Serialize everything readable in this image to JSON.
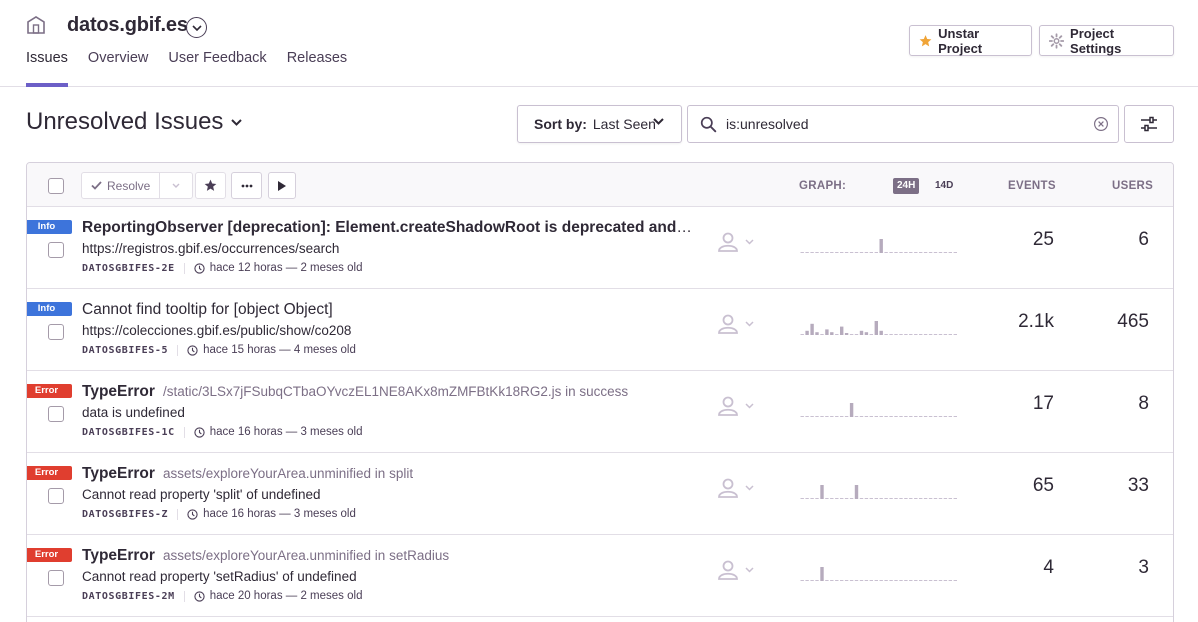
{
  "project": {
    "name": "datos.gbif.es"
  },
  "nav": {
    "tabs": [
      {
        "label": "Issues"
      },
      {
        "label": "Overview"
      },
      {
        "label": "User Feedback"
      },
      {
        "label": "Releases"
      }
    ]
  },
  "header_buttons": {
    "unstar": "Unstar Project",
    "settings": "Project Settings"
  },
  "page": {
    "title": "Unresolved Issues"
  },
  "sort": {
    "label": "Sort by:",
    "value": "Last Seen"
  },
  "search": {
    "value": "is:unresolved"
  },
  "list_header": {
    "resolve": "Resolve",
    "graph": "GRAPH:",
    "toggle_24h": "24H",
    "toggle_14d": "14D",
    "events": "EVENTS",
    "users": "USERS"
  },
  "colors": {
    "accent": "#6c5fc7",
    "info": "#3d74db",
    "error": "#e03e2f"
  },
  "issues": [
    {
      "level": "Info",
      "title": "ReportingObserver [deprecation]: Element.createShadowRoot is deprecated and w…",
      "location": "",
      "message": "https://registros.gbif.es/occurrences/search",
      "short_id": "DATOSGBIFES-2E",
      "time": "hace 12 horas — 2 meses old",
      "events": "25",
      "users": "6",
      "spark": [
        0,
        0,
        0,
        0,
        0,
        0,
        0,
        0,
        0,
        0,
        0,
        0,
        0,
        0,
        0,
        0,
        1,
        0,
        0,
        0,
        0,
        0,
        0,
        0,
        0,
        0,
        0,
        0,
        0,
        0,
        0,
        0
      ]
    },
    {
      "level": "Info",
      "title": "Cannot find tooltip for [object Object]",
      "location": "",
      "message": "https://colecciones.gbif.es/public/show/co208",
      "short_id": "DATOSGBIFES-5",
      "time": "hace 15 horas — 4 meses old",
      "events": "2.1k",
      "users": "465",
      "spark": [
        0,
        3,
        8,
        2,
        0,
        4,
        2,
        0,
        6,
        1,
        0,
        0,
        3,
        2,
        0,
        10,
        3,
        0,
        0,
        0,
        0,
        0,
        0,
        0,
        0,
        0,
        0,
        0,
        0,
        0,
        0,
        0
      ]
    },
    {
      "level": "Error",
      "title": "TypeError",
      "location": "/static/3LSx7jFSubqCTbaOYvczEL1NE8AKx8mZMFBtKk18RG2.js in success",
      "message": "data is undefined",
      "short_id": "DATOSGBIFES-1C",
      "time": "hace 16 horas — 3 meses old",
      "events": "17",
      "users": "8",
      "spark": [
        0,
        0,
        0,
        0,
        0,
        0,
        0,
        0,
        0,
        0,
        1,
        0,
        0,
        0,
        0,
        0,
        0,
        0,
        0,
        0,
        0,
        0,
        0,
        0,
        0,
        0,
        0,
        0,
        0,
        0,
        0,
        0
      ]
    },
    {
      "level": "Error",
      "title": "TypeError",
      "location": "assets/exploreYourArea.unminified in split",
      "message": "Cannot read property 'split' of undefined",
      "short_id": "DATOSGBIFES-Z",
      "time": "hace 16 horas — 3 meses old",
      "events": "65",
      "users": "33",
      "spark": [
        0,
        0,
        0,
        0,
        1,
        0,
        0,
        0,
        0,
        0,
        0,
        1,
        0,
        0,
        0,
        0,
        0,
        0,
        0,
        0,
        0,
        0,
        0,
        0,
        0,
        0,
        0,
        0,
        0,
        0,
        0,
        0
      ]
    },
    {
      "level": "Error",
      "title": "TypeError",
      "location": "assets/exploreYourArea.unminified in setRadius",
      "message": "Cannot read property 'setRadius' of undefined",
      "short_id": "DATOSGBIFES-2M",
      "time": "hace 20 horas — 2 meses old",
      "events": "4",
      "users": "3",
      "spark": [
        0,
        0,
        0,
        0,
        1,
        0,
        0,
        0,
        0,
        0,
        0,
        0,
        0,
        0,
        0,
        0,
        0,
        0,
        0,
        0,
        0,
        0,
        0,
        0,
        0,
        0,
        0,
        0,
        0,
        0,
        0,
        0
      ]
    }
  ]
}
